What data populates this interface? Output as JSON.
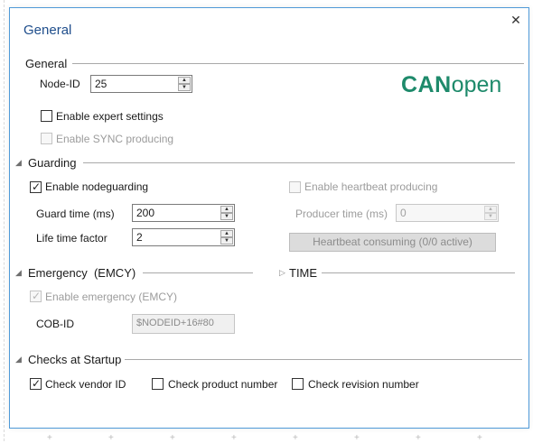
{
  "dialog": {
    "title": "General",
    "close_label": "✕"
  },
  "general": {
    "title": "General",
    "node_id_label": "Node-ID",
    "node_id_value": "25",
    "logo_can": "CAN",
    "logo_open": "open",
    "enable_expert_label": "Enable expert settings",
    "enable_expert_checked": false,
    "enable_sync_label": "Enable SYNC producing",
    "enable_sync_checked": false
  },
  "guarding": {
    "title": "Guarding",
    "enable_nodeguarding_label": "Enable nodeguarding",
    "enable_nodeguarding_checked": true,
    "guard_time_label": "Guard time (ms)",
    "guard_time_value": "200",
    "life_time_factor_label": "Life time factor",
    "life_time_factor_value": "2",
    "enable_heartbeat_label": "Enable heartbeat producing",
    "enable_heartbeat_checked": false,
    "producer_time_label": "Producer time (ms)",
    "producer_time_value": "0",
    "heartbeat_consuming_label": "Heartbeat consuming (0/0 active)"
  },
  "emergency": {
    "title": "Emergency  (EMCY)",
    "enable_emcy_label": "Enable emergency (EMCY)",
    "enable_emcy_checked": true,
    "cob_id_label": "COB-ID",
    "cob_id_value": "$NODEID+16#80"
  },
  "time": {
    "title": "TIME"
  },
  "checks": {
    "title": "Checks at Startup",
    "vendor_id_label": "Check vendor ID",
    "vendor_id_checked": true,
    "product_number_label": "Check product number",
    "product_number_checked": false,
    "revision_number_label": "Check revision number",
    "revision_number_checked": false
  }
}
